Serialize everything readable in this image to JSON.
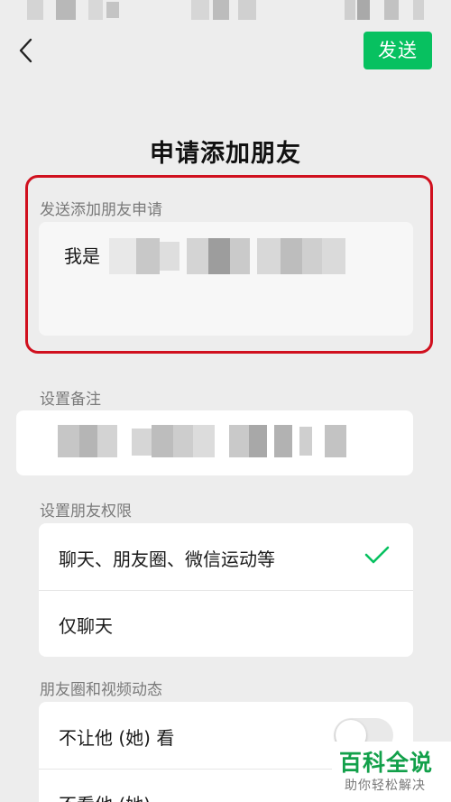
{
  "header": {
    "back_icon": "chevron-left-icon",
    "send_label": "发送"
  },
  "page_title": "申请添加朋友",
  "request_section": {
    "label": "发送添加朋友申请",
    "message_prefix": "我是"
  },
  "remark_section": {
    "label": "设置备注"
  },
  "permission_section": {
    "label": "设置朋友权限",
    "options": [
      {
        "label": "聊天、朋友圈、微信运动等",
        "selected": true
      },
      {
        "label": "仅聊天",
        "selected": false
      }
    ]
  },
  "moments_section": {
    "label": "朋友圈和视频动态",
    "toggles": [
      {
        "label": "不让他 (她) 看",
        "on": false
      },
      {
        "label": "不看他 (她)",
        "on": false
      }
    ]
  },
  "watermark": {
    "title": "百科全说",
    "subtitle": "助你轻松解决"
  },
  "colors": {
    "accent": "#07c160",
    "highlight": "#d0101e",
    "background": "#ededed"
  }
}
